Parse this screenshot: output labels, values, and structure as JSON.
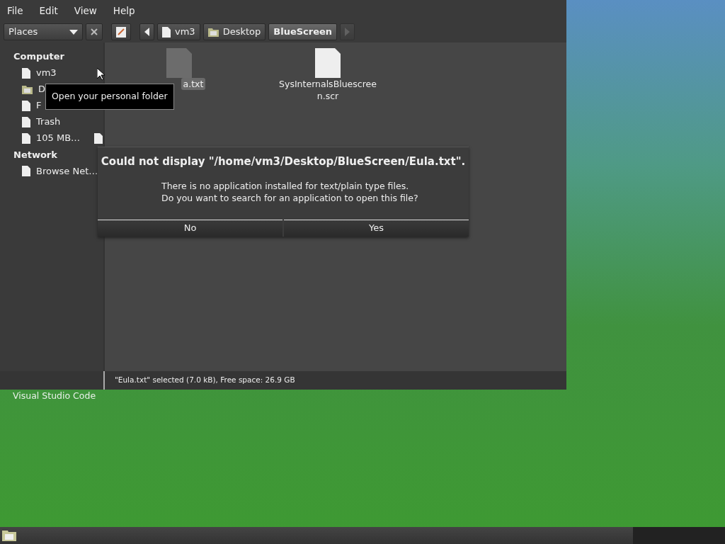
{
  "menu": [
    "File",
    "Edit",
    "View",
    "Help"
  ],
  "places_selector": {
    "label": "Places"
  },
  "breadcrumbs": [
    {
      "label": "vm3",
      "kind": "home",
      "selected": false
    },
    {
      "label": "Desktop",
      "kind": "folder",
      "selected": false
    },
    {
      "label": "BlueScreen",
      "kind": "current",
      "selected": true
    }
  ],
  "sidebar": [
    {
      "heading": "Computer",
      "items": [
        {
          "label": "vm3",
          "kind": "place"
        },
        {
          "label": "D",
          "kind": "folder"
        },
        {
          "label": "F",
          "kind": "place"
        },
        {
          "label": "Trash",
          "kind": "place"
        },
        {
          "label": "105 MB…",
          "kind": "drive"
        }
      ]
    },
    {
      "heading": "Network",
      "items": [
        {
          "label": "Browse Net…",
          "kind": "place"
        }
      ]
    }
  ],
  "files": [
    {
      "label": "a.txt",
      "selected": true,
      "kind": "text"
    },
    {
      "label": "SysInternalsBluescree n.scr",
      "selected": false,
      "kind": "program"
    }
  ],
  "tooltip": "Open your personal folder",
  "dialog": {
    "title": "Could not display \"/home/vm3/Desktop/BlueScreen/Eula.txt\".",
    "message": [
      "There is no application installed for text/plain type files.",
      "Do you want to search for an application to open this file?"
    ],
    "buttons": [
      "No",
      "Yes"
    ]
  },
  "status_bar": "\"Eula.txt\" selected (7.0 kB), Free space: 26.9 GB",
  "desktop_icon_label": "Visual Studio Code"
}
